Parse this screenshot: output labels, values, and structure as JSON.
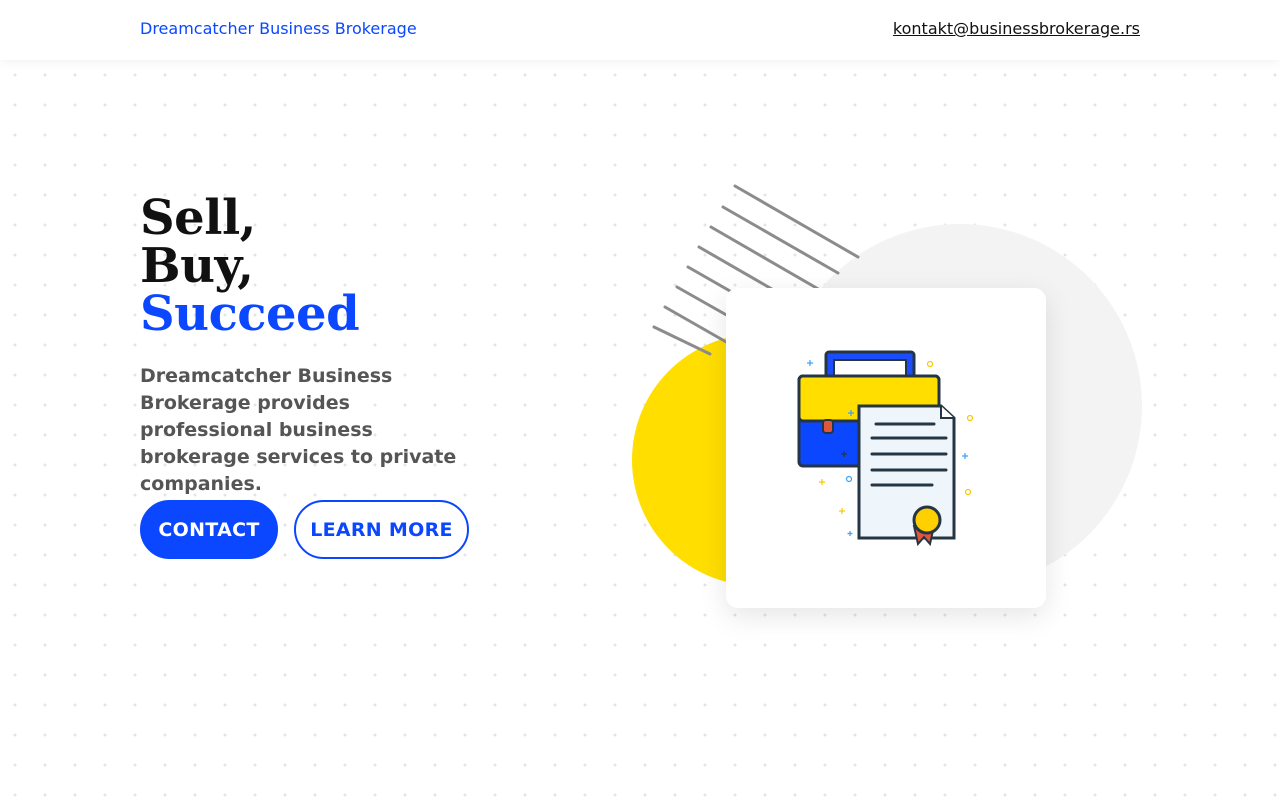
{
  "header": {
    "brand": "Dreamcatcher Business Brokerage",
    "email": "kontakt@businessbrokerage.rs"
  },
  "hero": {
    "title_line1": "Sell,",
    "title_line2": "Buy,",
    "title_line3": "Succeed",
    "description": "Dreamcatcher Business Brokerage provides professional business brokerage services to private companies.",
    "contact_label": "CONTACT",
    "learn_more_label": "LEARN MORE"
  },
  "colors": {
    "accent": "#0a47ff",
    "yellow": "#ffde00",
    "text": "#111111",
    "muted": "#555555"
  },
  "icons": {
    "card": "briefcase-certificate-icon"
  }
}
